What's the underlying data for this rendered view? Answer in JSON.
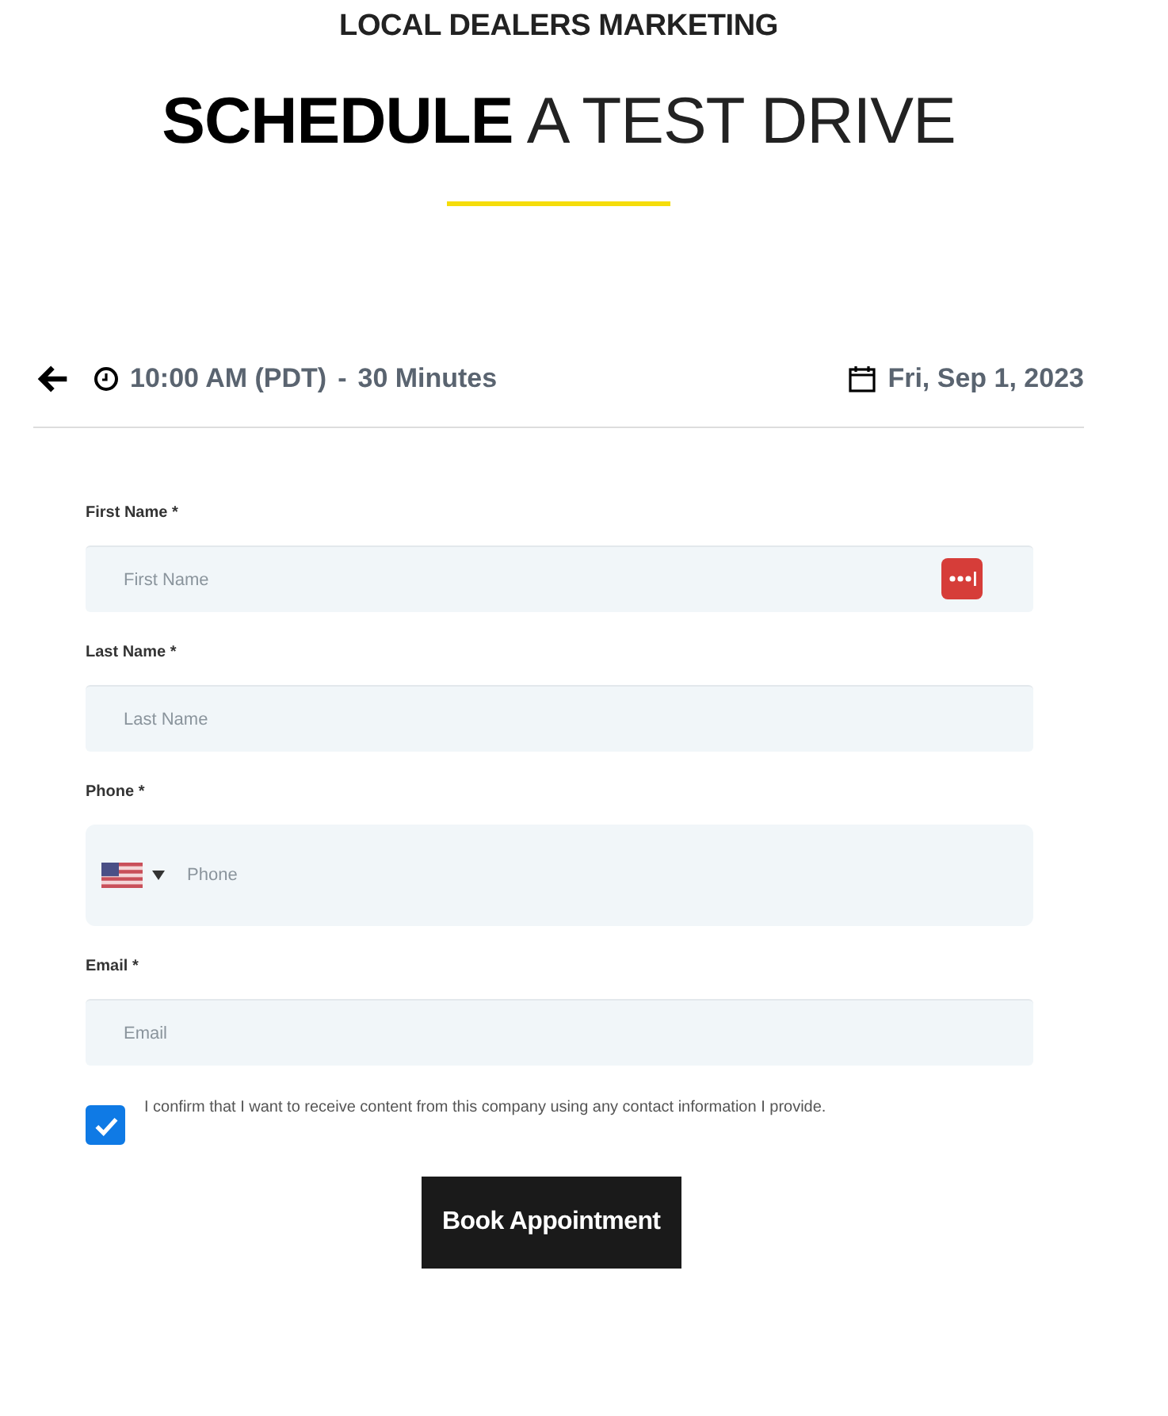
{
  "brand": "LOCAL DEALERS MARKETING",
  "title": "**SCHEDULE** A TEST DRIVE",
  "booking": {
    "time": "10:00 AM (PDT)",
    "separator": "-",
    "duration": "30 Minutes",
    "date": "Fri, Sep 1, 2023"
  },
  "fields": [
    {
      "kind": "text",
      "label": "First Name *",
      "placeholder": "First Name",
      "autofill_icon": true
    },
    {
      "kind": "text",
      "label": "Last Name *",
      "placeholder": "Last Name",
      "autofill_icon": false
    },
    {
      "kind": "phone",
      "label": "Phone *",
      "placeholder": "Phone",
      "autofill_icon": false
    },
    {
      "kind": "text",
      "label": "Email *",
      "placeholder": "Email",
      "autofill_icon": false
    }
  ],
  "consent": {
    "checked": true,
    "text": "I confirm that I want to receive content from this company using any contact information I provide."
  },
  "submit": "Book Appointment"
}
